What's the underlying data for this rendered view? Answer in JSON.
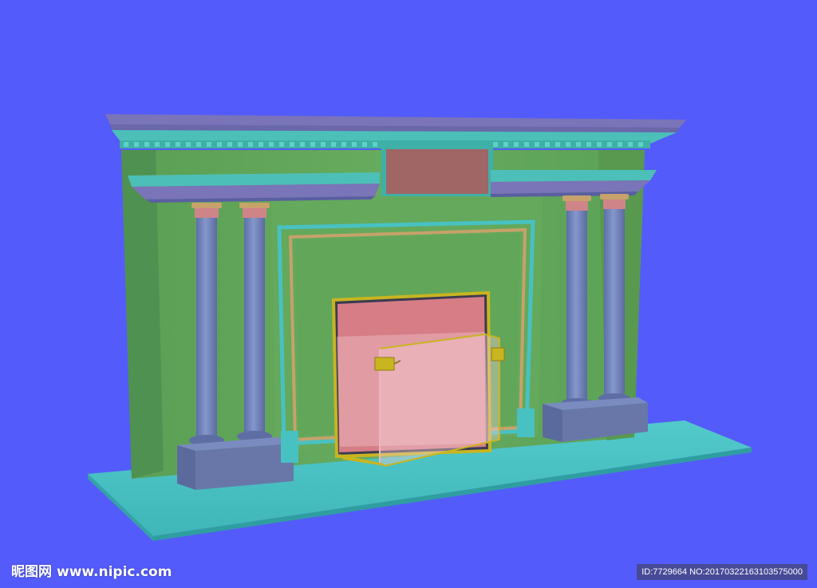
{
  "image": {
    "subject": "fireplace-3d-model",
    "colors": {
      "background": "#545bfb",
      "wall": "#61a55a",
      "wall_shadow": "#4f9150",
      "hearth": "#48c1c3",
      "column": "#6f83b9",
      "column_base": "#6877a8",
      "mantel_top": "#7a74b8",
      "cornice": "#4cc0b8",
      "panel": "#a06565",
      "firebox": "#d67d86",
      "screen": "#f0c0c8",
      "brass": "#c8b520"
    }
  },
  "watermark": {
    "brand_cn": "昵图网",
    "site": "www.nipic.com",
    "id_text": "ID:7729664",
    "no_text": "NO:20170322163103575000"
  }
}
